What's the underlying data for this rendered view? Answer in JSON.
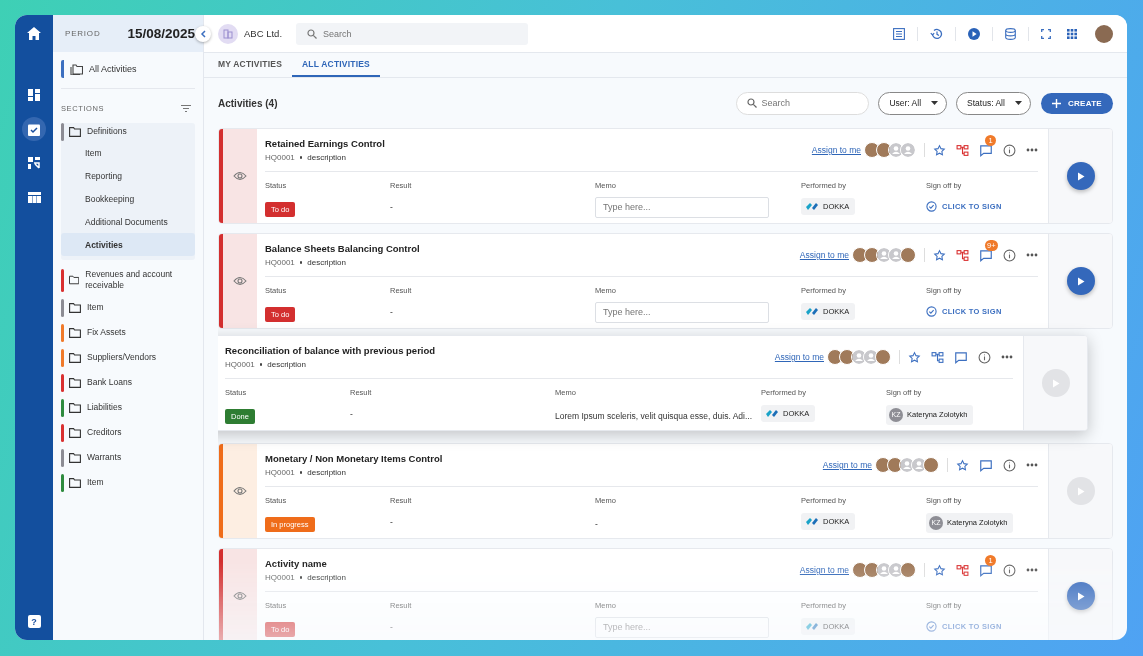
{
  "period": {
    "label": "PERIOD",
    "date": "15/08/2025"
  },
  "company": {
    "name": "ABC Ltd."
  },
  "help": "?",
  "top_search": {
    "placeholder": "Search"
  },
  "rail": [
    {
      "kind": "dashboard",
      "selected": false
    },
    {
      "kind": "tasks",
      "selected": true
    },
    {
      "kind": "transfer",
      "selected": false
    },
    {
      "kind": "table",
      "selected": false
    }
  ],
  "sidebar": {
    "all_activities": "All Activities",
    "sections_label": "SECTIONS",
    "sections": [
      {
        "label": "Definitions",
        "color": "#8c8c94",
        "expanded": true,
        "children": [
          {
            "label": "Item",
            "selected": false
          },
          {
            "label": "Reporting",
            "selected": false
          },
          {
            "label": "Bookkeeping",
            "selected": false
          },
          {
            "label": "Additional Documents",
            "selected": false
          },
          {
            "label": "Activities",
            "selected": true
          }
        ]
      },
      {
        "label": "Revenues and account receivable",
        "color": "#d93030",
        "expanded": false
      },
      {
        "label": "Item",
        "color": "#8c8c94",
        "expanded": false
      },
      {
        "label": "Fix Assets",
        "color": "#f07a2a",
        "expanded": false
      },
      {
        "label": "Suppliers/Vendors",
        "color": "#f07a2a",
        "expanded": false
      },
      {
        "label": "Bank Loans",
        "color": "#d93030",
        "expanded": false
      },
      {
        "label": "Liabilities",
        "color": "#2e8b3e",
        "expanded": false
      },
      {
        "label": "Creditors",
        "color": "#d93030",
        "expanded": false
      },
      {
        "label": "Warrants",
        "color": "#8c8c94",
        "expanded": false
      },
      {
        "label": "Item",
        "color": "#2e8b3e",
        "expanded": false
      }
    ]
  },
  "tabs": [
    {
      "label": "MY ACTIVITIES",
      "selected": false
    },
    {
      "label": "ALL ACTIVITIES",
      "selected": true
    }
  ],
  "toolbar": {
    "title": "Activities (4)",
    "search_placeholder": "Search",
    "filters": [
      "User: All",
      "Status: All"
    ],
    "create": "CREATE"
  },
  "activities": [
    {
      "title": "Retained Earnings Control",
      "code": "HQ0001",
      "description": "description",
      "dragging": false,
      "assign": "Assign to me",
      "assignees": [
        {
          "kind": "photo"
        },
        {
          "kind": "photo"
        },
        {
          "kind": "empty"
        },
        {
          "kind": "empty"
        }
      ],
      "workflow": {
        "kind": "alert"
      },
      "comment_badge": "1",
      "columns": [
        "Status",
        "Result",
        "Memo",
        "Performed by",
        "Sign off by"
      ],
      "status": {
        "kind": "todo",
        "label": "To do"
      },
      "result": "-",
      "memo": {
        "kind": "field",
        "placeholder": "Type here..."
      },
      "performed_by": "DOKKA",
      "sign_off": {
        "kind": "button",
        "label": "CLICK TO SIGN"
      },
      "play_enabled": true
    },
    {
      "title": "Balance Sheets Balancing Control",
      "code": "HQ0001",
      "description": "description",
      "dragging": false,
      "assign": "Assign to me",
      "assignees": [
        {
          "kind": "photo"
        },
        {
          "kind": "photo"
        },
        {
          "kind": "empty"
        },
        {
          "kind": "empty"
        },
        {
          "kind": "photo"
        }
      ],
      "workflow": {
        "kind": "alert"
      },
      "comment_badge": "9+",
      "columns": [
        "Status",
        "Result",
        "Memo",
        "Performed by",
        "Sign off by"
      ],
      "status": {
        "kind": "todo",
        "label": "To do"
      },
      "result": "-",
      "memo": {
        "kind": "field",
        "placeholder": "Type here..."
      },
      "performed_by": "DOKKA",
      "sign_off": {
        "kind": "button",
        "label": "CLICK TO SIGN"
      },
      "play_enabled": true
    },
    {
      "title": "Reconciliation of balance with previous period",
      "code": "HQ0001",
      "description": "description",
      "dragging": true,
      "assign": "Assign to me",
      "assignees": [
        {
          "kind": "photo"
        },
        {
          "kind": "photo"
        },
        {
          "kind": "empty"
        },
        {
          "kind": "empty"
        },
        {
          "kind": "photo"
        }
      ],
      "workflow": {
        "kind": "normal"
      },
      "columns": [
        "Status",
        "Result",
        "Memo",
        "Performed by",
        "Sign off by"
      ],
      "status": {
        "kind": "done",
        "label": "Done"
      },
      "result": "-",
      "memo": {
        "kind": "text",
        "text": "Lorem Ipsum sceleris, velit quisqua esse, duis. Adi..."
      },
      "performed_by": "DOKKA",
      "sign_off": {
        "kind": "person",
        "initials": "KZ",
        "name": "Kateryna Zolotykh"
      },
      "play_enabled": false
    },
    {
      "title": "Monetary / Non Monetary Items Control",
      "code": "HQ0001",
      "description": "description",
      "dragging": false,
      "assign": "Assign to me",
      "assignees": [
        {
          "kind": "photo"
        },
        {
          "kind": "photo"
        },
        {
          "kind": "empty"
        },
        {
          "kind": "empty"
        },
        {
          "kind": "photo"
        }
      ],
      "columns": [
        "Status",
        "Result",
        "Memo",
        "Performed by",
        "Sign off by"
      ],
      "status": {
        "kind": "progress",
        "label": "In progress"
      },
      "result": "-",
      "memo": {
        "kind": "text",
        "text": "-"
      },
      "performed_by": "DOKKA",
      "sign_off": {
        "kind": "person",
        "initials": "KZ",
        "name": "Kateryna Zolotykh"
      },
      "play_enabled": false
    },
    {
      "title": "Activity name",
      "code": "HQ0001",
      "description": "description",
      "dragging": false,
      "assign": "Assign to me",
      "assignees": [
        {
          "kind": "photo"
        },
        {
          "kind": "photo"
        },
        {
          "kind": "empty"
        },
        {
          "kind": "empty"
        },
        {
          "kind": "photo"
        }
      ],
      "workflow": {
        "kind": "alert"
      },
      "comment_badge": "1",
      "columns": [
        "Status",
        "Result",
        "Memo",
        "Performed by",
        "Sign off by"
      ],
      "status": {
        "kind": "todo",
        "label": "To do"
      },
      "result": "-",
      "memo": {
        "kind": "field",
        "placeholder": "Type here..."
      },
      "performed_by": "DOKKA",
      "sign_off": {
        "kind": "button",
        "label": "CLICK TO SIGN"
      },
      "play_enabled": true
    }
  ]
}
